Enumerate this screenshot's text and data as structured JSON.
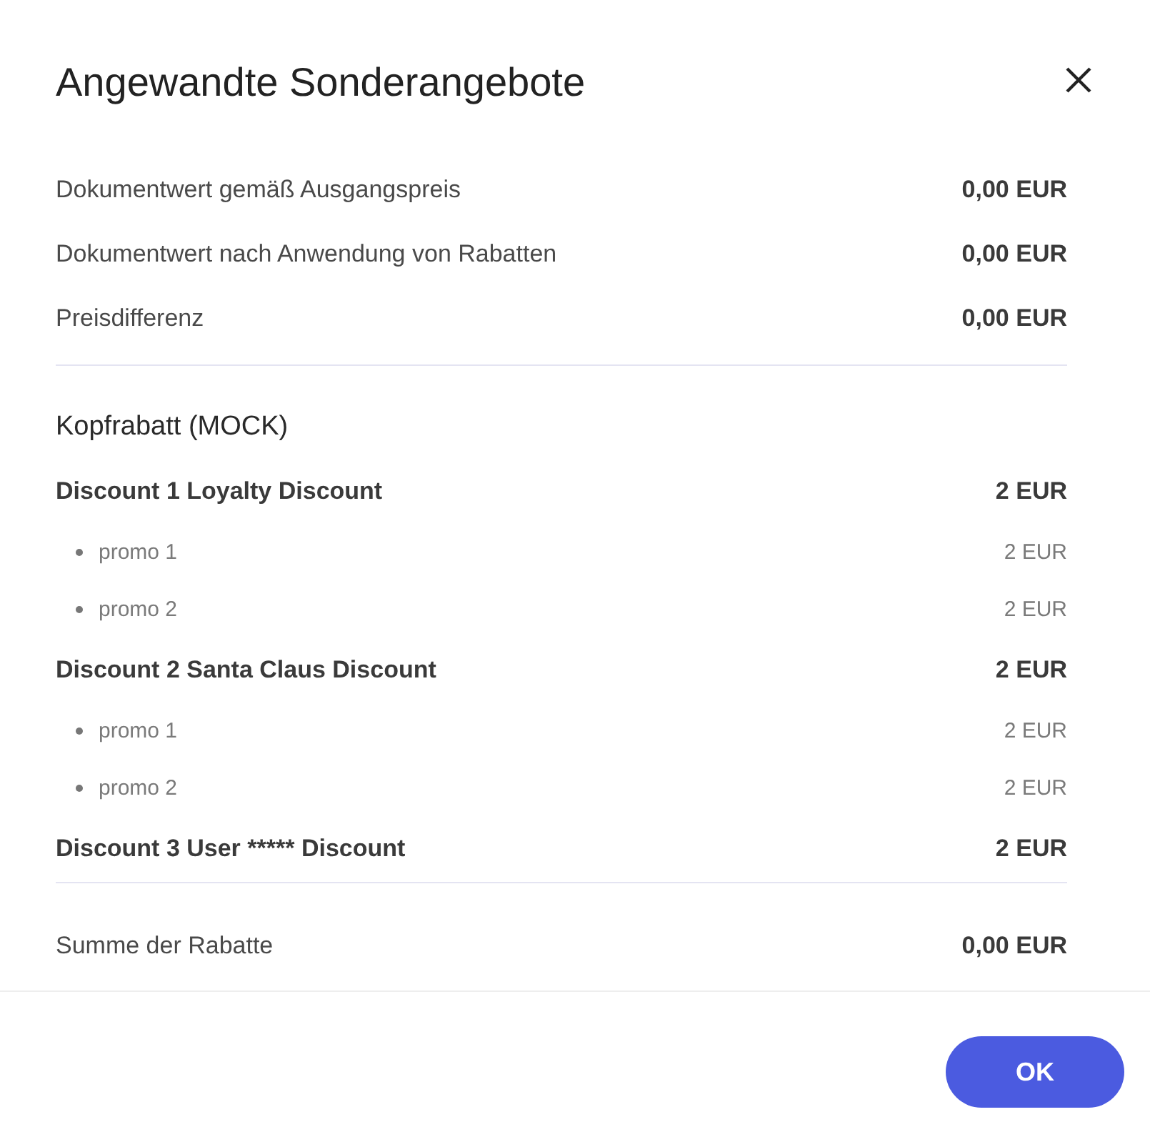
{
  "dialog": {
    "title": "Angewandte Sonderangebote"
  },
  "summary": [
    {
      "label": "Dokumentwert gemäß Ausgangspreis",
      "value": "0,00 EUR"
    },
    {
      "label": "Dokumentwert nach Anwendung von Rabatten",
      "value": "0,00 EUR"
    },
    {
      "label": "Preisdifferenz",
      "value": "0,00 EUR"
    }
  ],
  "section": {
    "title": "Kopfrabatt (MOCK)",
    "discounts": [
      {
        "name": "Discount 1 Loyalty Discount",
        "amount": "2 EUR",
        "promos": [
          {
            "name": "promo 1",
            "amount": "2 EUR"
          },
          {
            "name": "promo 2",
            "amount": "2 EUR"
          }
        ]
      },
      {
        "name": "Discount 2 Santa Claus Discount",
        "amount": "2 EUR",
        "promos": [
          {
            "name": "promo 1",
            "amount": "2 EUR"
          },
          {
            "name": "promo 2",
            "amount": "2 EUR"
          }
        ]
      },
      {
        "name": "Discount 3 User ***** Discount",
        "amount": "2 EUR"
      }
    ]
  },
  "total": {
    "label": "Summe der Rabatte",
    "value": "0,00 EUR"
  },
  "buttons": [
    {
      "label": "OK"
    }
  ]
}
